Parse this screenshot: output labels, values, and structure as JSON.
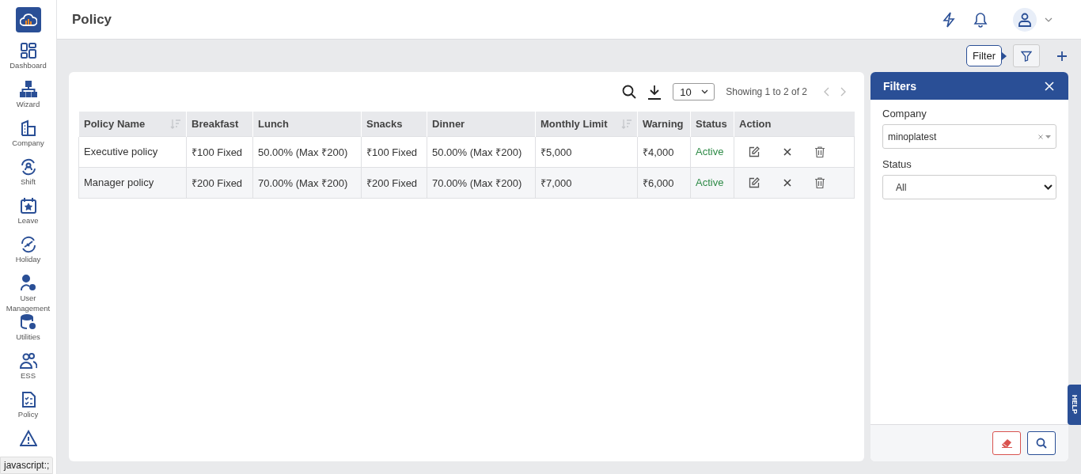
{
  "sidebar": {
    "items": [
      {
        "label": "Dashboard",
        "selected": false
      },
      {
        "label": "Wizard",
        "selected": false
      },
      {
        "label": "Company",
        "selected": false
      },
      {
        "label": "Shift",
        "selected": false
      },
      {
        "label": "Leave",
        "selected": false
      },
      {
        "label": "Holiday",
        "selected": false
      },
      {
        "label": "User Management",
        "selected": false
      },
      {
        "label": "Utilities",
        "selected": false
      },
      {
        "label": "ESS",
        "selected": false
      },
      {
        "label": "Policy",
        "selected": false
      },
      {
        "selected": false
      }
    ]
  },
  "header": {
    "title": "Policy"
  },
  "toolbar": {
    "tooltip": "Filter"
  },
  "table_tools": {
    "page_size": "10",
    "showing": "Showing 1 to 2 of 2",
    "prev": {
      "disabled": true
    },
    "next": {
      "disabled": true
    }
  },
  "table": {
    "columns": [
      {
        "label": "Policy Name",
        "sortable": true
      },
      {
        "label": "Breakfast",
        "sortable": false
      },
      {
        "label": "Lunch",
        "sortable": false
      },
      {
        "label": "Snacks",
        "sortable": false
      },
      {
        "label": "Dinner",
        "sortable": false
      },
      {
        "label": "Monthly Limit",
        "sortable": true
      },
      {
        "label": "Warning",
        "sortable": false
      },
      {
        "label": "Status",
        "sortable": false
      },
      {
        "label": "Action",
        "sortable": false
      }
    ],
    "rows": [
      {
        "cells": [
          "Executive policy",
          "₹100 Fixed",
          "50.00% (Max ₹200)",
          "₹100 Fixed",
          "50.00% (Max ₹200)",
          "₹5,000",
          "₹4,000"
        ],
        "status": "Active"
      },
      {
        "cells": [
          "Manager policy",
          "₹200 Fixed",
          "70.00% (Max ₹200)",
          "₹200 Fixed",
          "70.00% (Max ₹200)",
          "₹7,000",
          "₹6,000"
        ],
        "status": "Active"
      }
    ]
  },
  "filters": {
    "title": "Filters",
    "fields": [
      {
        "kind": "combo",
        "label": "Company",
        "value": "minoplatest"
      },
      {
        "kind": "select",
        "label": "Status",
        "value": "All"
      }
    ]
  },
  "help_tab": "HELP",
  "browser_status": "javascript:;"
}
